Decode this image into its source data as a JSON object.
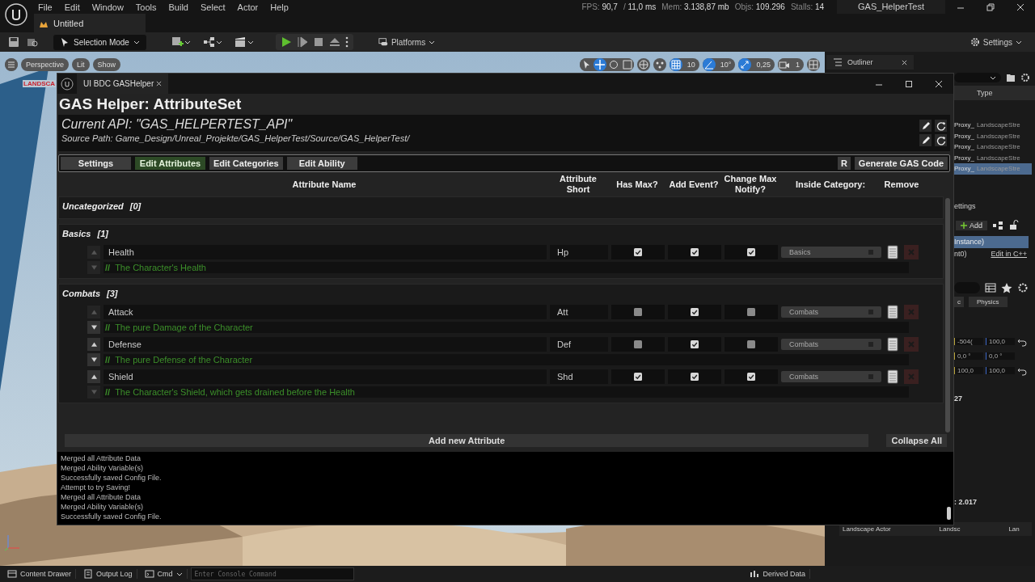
{
  "menu": [
    "File",
    "Edit",
    "Window",
    "Tools",
    "Build",
    "Select",
    "Actor",
    "Help"
  ],
  "document_tab": {
    "label": "Untitled"
  },
  "stats": [
    {
      "label": "FPS:",
      "value": "90,7"
    },
    {
      "label": "/",
      "value": "11,0 ms"
    },
    {
      "label": "Mem:",
      "value": "3.138,87 mb"
    },
    {
      "label": "Objs:",
      "value": "109.296"
    },
    {
      "label": "Stalls:",
      "value": "14"
    }
  ],
  "project": "GAS_HelperTest",
  "toolbar": {
    "mode": "Selection Mode",
    "platforms": "Platforms",
    "settings": "Settings"
  },
  "viewport": {
    "overlay_text": "LANDSCA",
    "view_buttons": [
      "Perspective",
      "Lit",
      "Show"
    ],
    "grid": "10",
    "angle": "10°",
    "scale": "0,25",
    "camera": "1"
  },
  "outliner": {
    "tab": "Outliner",
    "column": "Type",
    "rows": [
      {
        "name": "Proxy_",
        "type": "LandscapeStre",
        "selected": false
      },
      {
        "name": "Proxy_",
        "type": "LandscapeStre",
        "selected": false
      },
      {
        "name": "Proxy_",
        "type": "LandscapeStre",
        "selected": false
      },
      {
        "name": "Proxy_",
        "type": "LandscapeStre",
        "selected": false
      },
      {
        "name": "Proxy_",
        "type": "LandscapeStre",
        "selected": true
      }
    ]
  },
  "details": {
    "section": "ettings",
    "add": "Add",
    "component": "Instance)",
    "sub": "nt0)",
    "edit_link": "Edit in C++",
    "filter_tabs": [
      "c",
      "Physics"
    ],
    "transform": [
      {
        "a": "-504(",
        "b": "100,0",
        "reset": true
      },
      {
        "a": "0,0 °",
        "b": "0,0 °",
        "reset": false
      },
      {
        "a": "100,0",
        "b": "100,0",
        "reset": true
      }
    ],
    "value_a": "27",
    "value_b": ": 2.017",
    "footer": [
      "Landscape Actor",
      "Landsc",
      "Lan"
    ]
  },
  "dialog": {
    "tab": "UI BDC GASHelper",
    "title": "GAS Helper: AttributeSet",
    "api": "Current API: \"GAS_HELPERTEST_API\"",
    "source_path": "Source Path: Game_Design/Unreal_Projekte/GAS_HelperTest/Source/GAS_HelperTest/",
    "nav": [
      {
        "label": "Settings",
        "selected": false
      },
      {
        "label": "Edit Attributes",
        "selected": true
      },
      {
        "label": "Edit Categories",
        "selected": false
      },
      {
        "label": "Edit Ability",
        "selected": false
      }
    ],
    "reset_button": "R",
    "generate_button": "Generate GAS Code",
    "columns": [
      "Attribute Name",
      "Attribute Short",
      "Has Max?",
      "Add Event?",
      "Change Max Notify?",
      "Inside Category:",
      "Remove"
    ],
    "categories": [
      {
        "name": "Uncategorized",
        "count": "[0]"
      },
      {
        "name": "Basics",
        "count": "[1]",
        "attributes": [
          {
            "name": "Health",
            "short": "Hp",
            "has_max": true,
            "add_event": true,
            "change_max_notify": true,
            "category": "Basics",
            "comment": "//",
            "description": "The Character's Health",
            "can_move_up": false,
            "can_move_down": false
          }
        ]
      },
      {
        "name": "Combats",
        "count": "[3]",
        "attributes": [
          {
            "name": "Attack",
            "short": "Att",
            "has_max": false,
            "add_event": true,
            "change_max_notify": false,
            "category": "Combats",
            "comment": "//",
            "description": "The pure Damage of the Character",
            "can_move_up": false,
            "can_move_down": true
          },
          {
            "name": "Defense",
            "short": "Def",
            "has_max": false,
            "add_event": true,
            "change_max_notify": false,
            "category": "Combats",
            "comment": "//",
            "description": "The pure Defense of the Character",
            "can_move_up": true,
            "can_move_down": true
          },
          {
            "name": "Shield",
            "short": "Shd",
            "has_max": true,
            "add_event": true,
            "change_max_notify": true,
            "category": "Combats",
            "comment": "//",
            "description": "The Character's Shield, which gets drained before the Health",
            "can_move_up": true,
            "can_move_down": false
          }
        ]
      }
    ],
    "add_button": "Add new Attribute",
    "collapse_button": "Collapse All",
    "log": [
      "Merged all Attribute Data",
      "Merged Ability Variable(s)",
      "Successfully saved Config File.",
      "Attempt to try Saving!",
      "Merged all Attribute Data",
      "Merged Ability Variable(s)",
      "Successfully saved Config File."
    ]
  },
  "status_bar": {
    "content_drawer": "Content Drawer",
    "output_log": "Output Log",
    "cmd": "Cmd",
    "console_placeholder": "Enter Console Command",
    "derived_data": "Derived Data"
  }
}
